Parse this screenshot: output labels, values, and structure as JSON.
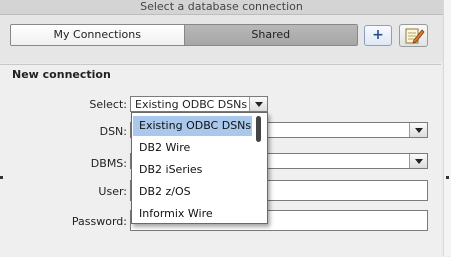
{
  "dialog": {
    "title": "Select a database connection"
  },
  "tabs": {
    "my_connections": "My Connections",
    "shared": "Shared"
  },
  "toolbar": {
    "add_label": "+"
  },
  "form": {
    "section_title": "New connection",
    "select_label": "Select:",
    "select_value": "Existing ODBC DSNs",
    "dsn_label": "DSN:",
    "dbms_label": "DBMS:",
    "user_label": "User:",
    "password_label": "Password:"
  },
  "dropdown": {
    "items": [
      "Existing ODBC DSNs",
      "DB2 Wire",
      "DB2 iSeries",
      "DB2 z/OS",
      "Informix Wire"
    ],
    "selected_index": 0
  },
  "icons": {
    "add": "plus-icon",
    "edit": "edit-pencil-icon"
  }
}
